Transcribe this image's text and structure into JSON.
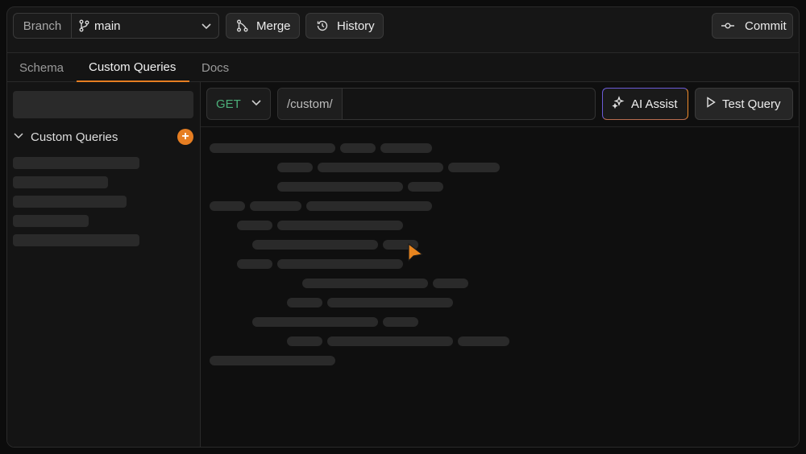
{
  "toolbar": {
    "branch_label": "Branch",
    "branch_value": "main",
    "merge_label": "Merge",
    "history_label": "History",
    "commit_label": "Commit"
  },
  "tabs": [
    {
      "label": "Schema",
      "active": false
    },
    {
      "label": "Custom Queries",
      "active": true
    },
    {
      "label": "Docs",
      "active": false
    }
  ],
  "sidebar": {
    "section_label": "Custom Queries"
  },
  "request": {
    "method": "GET",
    "url_prefix": "/custom/",
    "url_value": "",
    "ai_assist_label": "AI Assist",
    "test_query_label": "Test Query"
  },
  "colors": {
    "accent": "#e67e22",
    "method_get": "#4caf7a",
    "ai_gradient_start": "#6b5bd6",
    "ai_gradient_end": "#f08c2b"
  },
  "icons": {
    "branch": "git-branch-icon",
    "merge": "git-merge-icon",
    "history": "history-icon",
    "commit": "git-commit-icon",
    "ai": "sparkles-icon",
    "test": "play-icon"
  }
}
